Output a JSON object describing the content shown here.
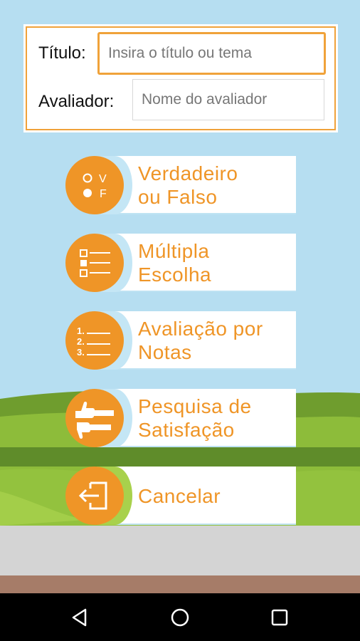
{
  "form": {
    "title_label": "Título:",
    "title_placeholder": "Insira o título ou tema",
    "evaluator_label": "Avaliador:",
    "evaluator_placeholder": "Nome do avaliador"
  },
  "options": [
    {
      "line1": "Verdadeiro",
      "line2": "ou Falso",
      "icon": "true-false-icon",
      "icon_text_v": "V",
      "icon_text_f": "F"
    },
    {
      "line1": "Múltipla",
      "line2": "Escolha",
      "icon": "multiple-choice-icon"
    },
    {
      "line1": "Avaliação por",
      "line2": "Notas",
      "icon": "numbered-list-icon",
      "icon_nums": [
        "1.",
        "2.",
        "3."
      ]
    },
    {
      "line1": "Pesquisa de",
      "line2": "Satisfação",
      "icon": "thumbs-icon"
    },
    {
      "line1": "Cancelar",
      "icon": "exit-icon"
    }
  ],
  "nav": {
    "back_icon": "back-triangle-icon",
    "home_icon": "home-circle-icon",
    "recent_icon": "recent-square-icon"
  },
  "colors": {
    "sky": "#b6def1",
    "accent_orange": "#ef9527",
    "grass_dark": "#6e9c2c",
    "grass_light": "#8fbf3a",
    "road_gray": "#d4d4d4",
    "soil_brown": "#a67c68"
  }
}
